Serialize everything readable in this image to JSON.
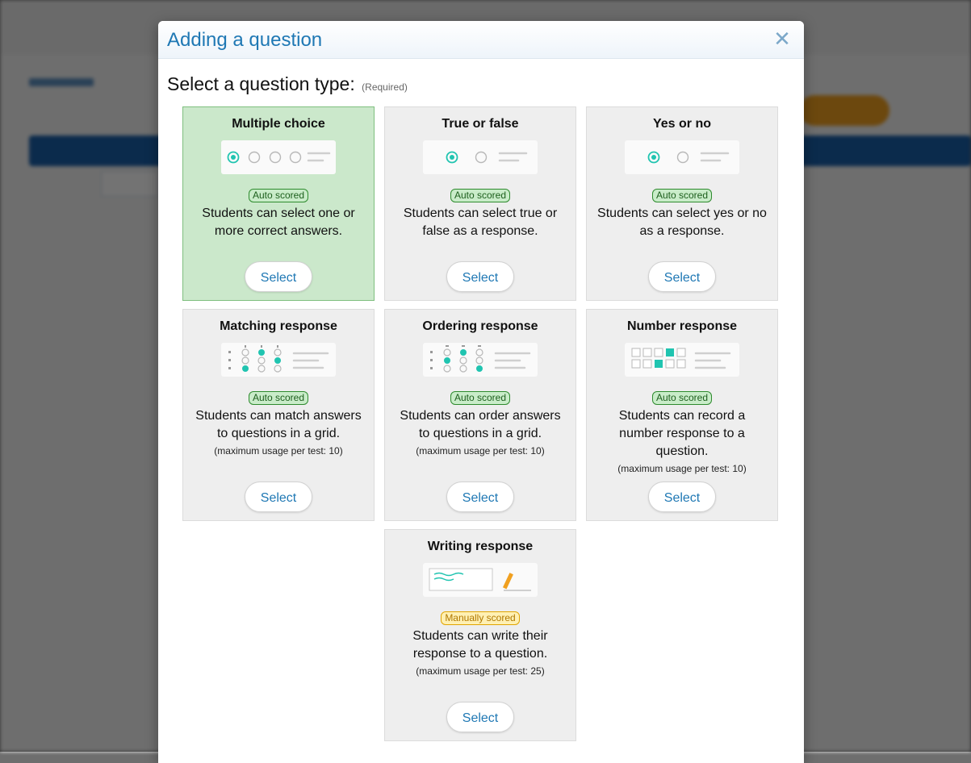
{
  "modal": {
    "title": "Adding a question",
    "close_label": "✕",
    "prompt": "Select a question type:",
    "required_label": "(Required)"
  },
  "cards": [
    {
      "title": "Multiple choice",
      "badge": "Auto scored",
      "description": "Students can select one or more correct answers.",
      "note": "",
      "select_label": "Select"
    },
    {
      "title": "True or false",
      "badge": "Auto scored",
      "description": "Students can select true or false as a response.",
      "note": "",
      "select_label": "Select"
    },
    {
      "title": "Yes or no",
      "badge": "Auto scored",
      "description": "Students can select yes or no as a response.",
      "note": "",
      "select_label": "Select"
    },
    {
      "title": "Matching response",
      "badge": "Auto scored",
      "description": "Students can match answers to questions in a grid.",
      "note": "(maximum usage per test: 10)",
      "select_label": "Select"
    },
    {
      "title": "Ordering response",
      "badge": "Auto scored",
      "description": "Students can order answers to questions in a grid.",
      "note": "(maximum usage per test: 10)",
      "select_label": "Select"
    },
    {
      "title": "Number response",
      "badge": "Auto scored",
      "description": "Students can record a number response to a question.",
      "note": "(maximum usage per test: 10)",
      "select_label": "Select"
    },
    {
      "title": "Writing response",
      "badge": "Manually scored",
      "description": "Students can write their response to a question.",
      "note": "(maximum usage per test: 25)",
      "select_label": "Select"
    }
  ],
  "colors": {
    "accent": "#1f78b4",
    "selected_card": "#cbe8cb",
    "auto_badge": "#c9ecc9",
    "manual_badge": "#fff0b3",
    "teal": "#20c4b0"
  }
}
